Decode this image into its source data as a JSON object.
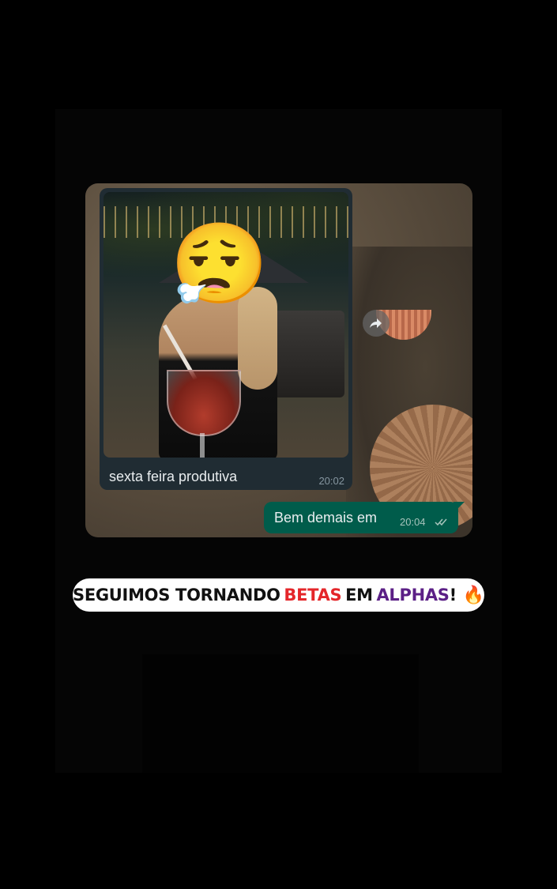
{
  "chat": {
    "incoming": {
      "caption": "sexta feira produtiva",
      "time": "20:02",
      "photo_overlay_emoji": "😮‍💨"
    },
    "forward_icon": "forward-arrow-icon",
    "outgoing": {
      "text": "Bem demais em",
      "time": "20:04",
      "status_icon": "double-check-icon"
    }
  },
  "banner": {
    "part1": "SEGUIMOS TORNANDO",
    "part2": "BETAS",
    "part3": "EM",
    "part4": "ALPHAS",
    "part5": "!",
    "emoji": "🔥",
    "colors": {
      "text": "#111111",
      "betas": "#e4262a",
      "alphas": "#5b1f86",
      "background": "#ffffff"
    }
  },
  "theme": {
    "incoming_bubble": "#202c33",
    "outgoing_bubble": "#005c4b",
    "page_background": "#000000"
  }
}
